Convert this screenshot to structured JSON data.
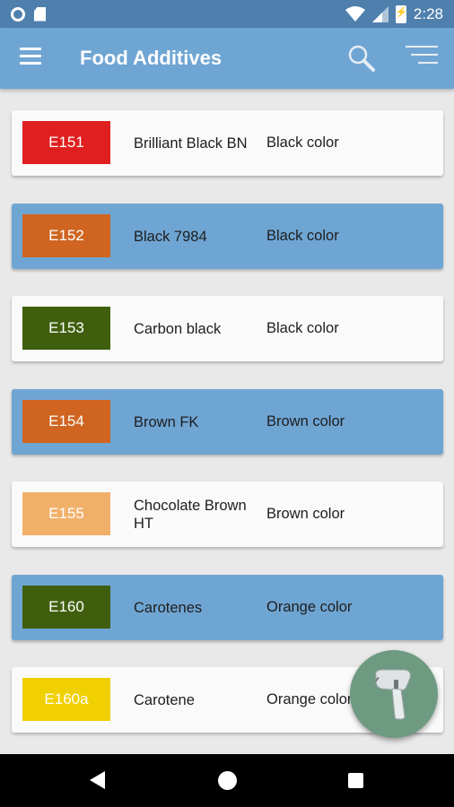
{
  "status_bar": {
    "time": "2:28",
    "icons": [
      "sync-circle-icon",
      "sim-card-icon",
      "wifi-icon",
      "signal-icon",
      "battery-charging-icon"
    ]
  },
  "app_bar": {
    "title": "Food Additives",
    "icons": [
      "menu-icon",
      "search-icon",
      "sort-icon"
    ],
    "color": "#6fa5d3"
  },
  "additives": [
    {
      "code": "E151",
      "name": "Brilliant Black BN",
      "category": "Black color",
      "swatch": "#e02020",
      "row_style": "white"
    },
    {
      "code": "E152",
      "name": "Black 7984",
      "category": "Black color",
      "swatch": "#cf6520",
      "row_style": "blue"
    },
    {
      "code": "E153",
      "name": "Carbon black",
      "category": "Black color",
      "swatch": "#3f5f0e",
      "row_style": "white"
    },
    {
      "code": "E154",
      "name": "Brown FK",
      "category": "Brown color",
      "swatch": "#cf6520",
      "row_style": "blue"
    },
    {
      "code": "E155",
      "name": "Chocolate Brown HT",
      "category": "Brown color",
      "swatch": "#f1b06a",
      "row_style": "white"
    },
    {
      "code": "E160",
      "name": "Carotenes",
      "category": "Orange color",
      "swatch": "#3f5f0e",
      "row_style": "blue"
    },
    {
      "code": "E160a",
      "name": "Carotene",
      "category": "Orange color",
      "swatch": "#f0d000",
      "row_style": "white"
    }
  ],
  "fab": {
    "icon": "barcode-scanner-icon",
    "color": "#6e9a82"
  },
  "nav_bar": {
    "icons": [
      "back-icon",
      "home-icon",
      "recents-icon"
    ]
  }
}
